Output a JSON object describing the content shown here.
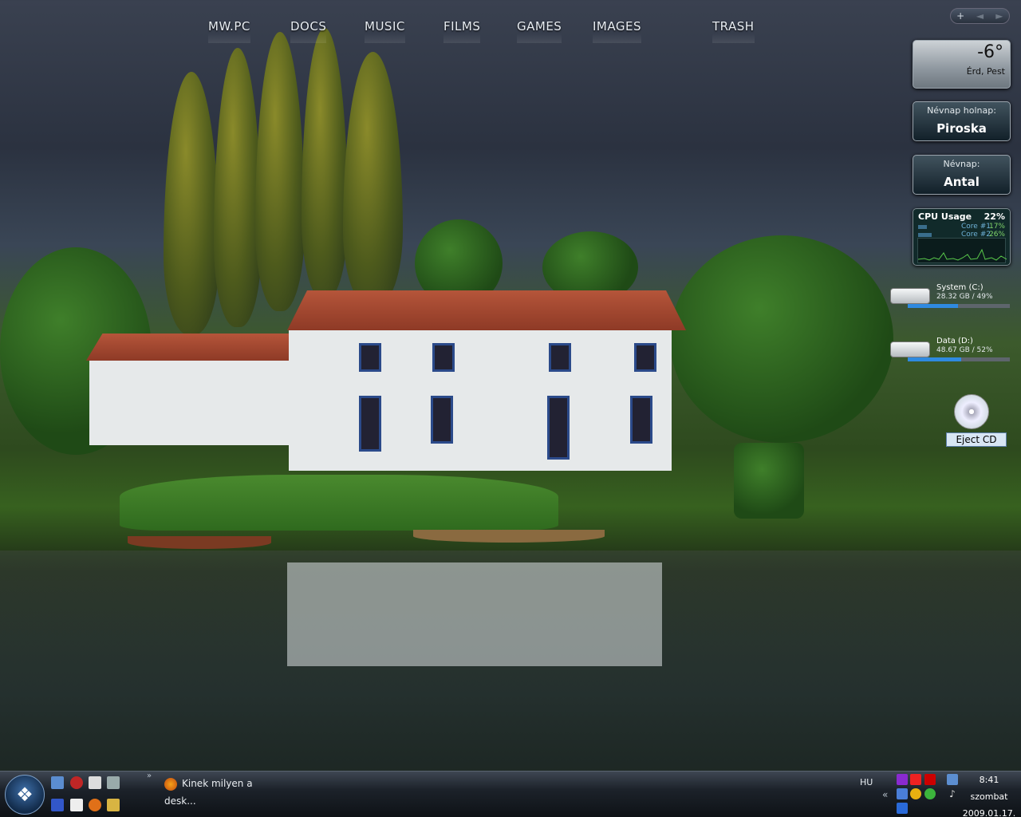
{
  "topnav": [
    "MW.PC",
    "DOCS",
    "MUSIC",
    "FILMS",
    "GAMES",
    "IMAGES",
    "TRASH"
  ],
  "sidebar": {
    "controls": [
      "+",
      "◄",
      "►"
    ],
    "weather": {
      "temp": "-6°",
      "city": "Érd, Pest"
    },
    "namedays": [
      {
        "label": "Névnap holnap:",
        "name": "Piroska"
      },
      {
        "label": "Névnap:",
        "name": "Antal"
      }
    ],
    "cpu": {
      "title": "CPU Usage",
      "total": "22%",
      "cores": [
        {
          "label": "Core #1",
          "pct": "17%",
          "value": 17
        },
        {
          "label": "Core #2",
          "pct": "26%",
          "value": 26
        }
      ]
    },
    "drives": [
      {
        "name": "System (C:)",
        "stat": "28.32 GB / 49%",
        "used": 49
      },
      {
        "name": "Data (D:)",
        "stat": "48.67 GB / 52%",
        "used": 52
      }
    ],
    "eject_label": "Eject CD"
  },
  "taskbar": {
    "start_glyph": "❖",
    "chevron": "»",
    "task": "Kinek milyen a desk...",
    "lang": "HU",
    "tray_chevron": "«",
    "clock": {
      "time": "8:41",
      "day": "szombat",
      "date": "2009.01.17."
    }
  },
  "colors": {
    "accent": "#2f8ae0",
    "taskbar": "#1c222a",
    "cpu_green": "#7fd46a"
  }
}
